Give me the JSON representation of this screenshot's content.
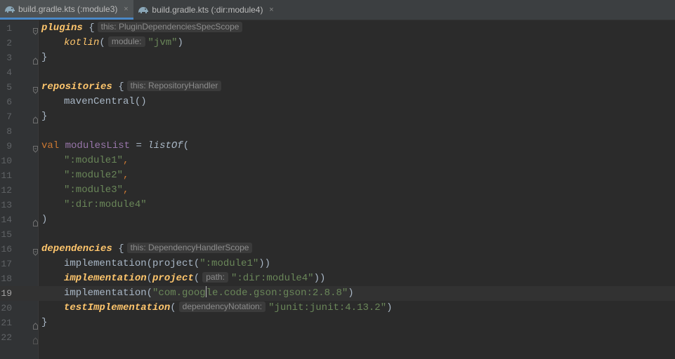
{
  "tabs": [
    {
      "label": "build.gradle.kts (:module3)",
      "active": true,
      "icon": "gradle-elephant-icon",
      "close": "×"
    },
    {
      "label": "build.gradle.kts (:dir:module4)",
      "active": false,
      "icon": "gradle-elephant-icon",
      "close": "×"
    }
  ],
  "colors": {
    "keyword": "#cc7832",
    "function": "#ffc66d",
    "string": "#6a8759",
    "variable": "#9876aa",
    "text": "#a9b7c6",
    "background": "#2b2b2b",
    "tab_accent": "#4a88c7"
  },
  "current_line": 19,
  "editor": {
    "line_numbers": [
      "1",
      "2",
      "3",
      "4",
      "5",
      "6",
      "7",
      "8",
      "9",
      "10",
      "11",
      "12",
      "13",
      "14",
      "15",
      "16",
      "17",
      "18",
      "19",
      "20",
      "21",
      "22"
    ],
    "l1": {
      "name": "plugins",
      "brace": " {",
      "hint": "this: PluginDependenciesSpecScope"
    },
    "l2": {
      "fn": "kotlin",
      "paren": "(",
      "hint": "module:",
      "arg": "\"jvm\"",
      "close": ")"
    },
    "l3": {
      "text": "}"
    },
    "l5": {
      "name": "repositories",
      "brace": " {",
      "hint": "this: RepositoryHandler"
    },
    "l6": {
      "text": "mavenCentral()"
    },
    "l7": {
      "text": "}"
    },
    "l9": {
      "kw": "val",
      "var": "modulesList",
      "op": " = ",
      "fn": "listOf",
      "paren": "("
    },
    "l10": {
      "str": "\":module1\"",
      "comma": ","
    },
    "l11": {
      "str": "\":module2\"",
      "comma": ","
    },
    "l12": {
      "str": "\":module3\"",
      "comma": ","
    },
    "l13": {
      "str": "\":dir:module4\""
    },
    "l14": {
      "text": ")"
    },
    "l16": {
      "name": "dependencies",
      "brace": " {",
      "hint": "this: DependencyHandlerScope"
    },
    "l17": {
      "pre": "implementation(project(",
      "str": "\":module1\"",
      "post": "))"
    },
    "l18": {
      "fn1": "implementation",
      "p1": "(",
      "fn2": "project",
      "p2": "(",
      "hint": "path:",
      "str": "\":dir:module4\"",
      "post": "))"
    },
    "l19": {
      "pre": "implementation(",
      "str_a": "\"com.goog",
      "str_b": "le.code.gson:gson:2.8.8\"",
      "post": ")"
    },
    "l20": {
      "fn": "testImplementation",
      "paren": "(",
      "hint": "dependencyNotation:",
      "str": "\"junit:junit:4.13.2\"",
      "post": ")"
    },
    "l21": {
      "text": "}"
    }
  }
}
